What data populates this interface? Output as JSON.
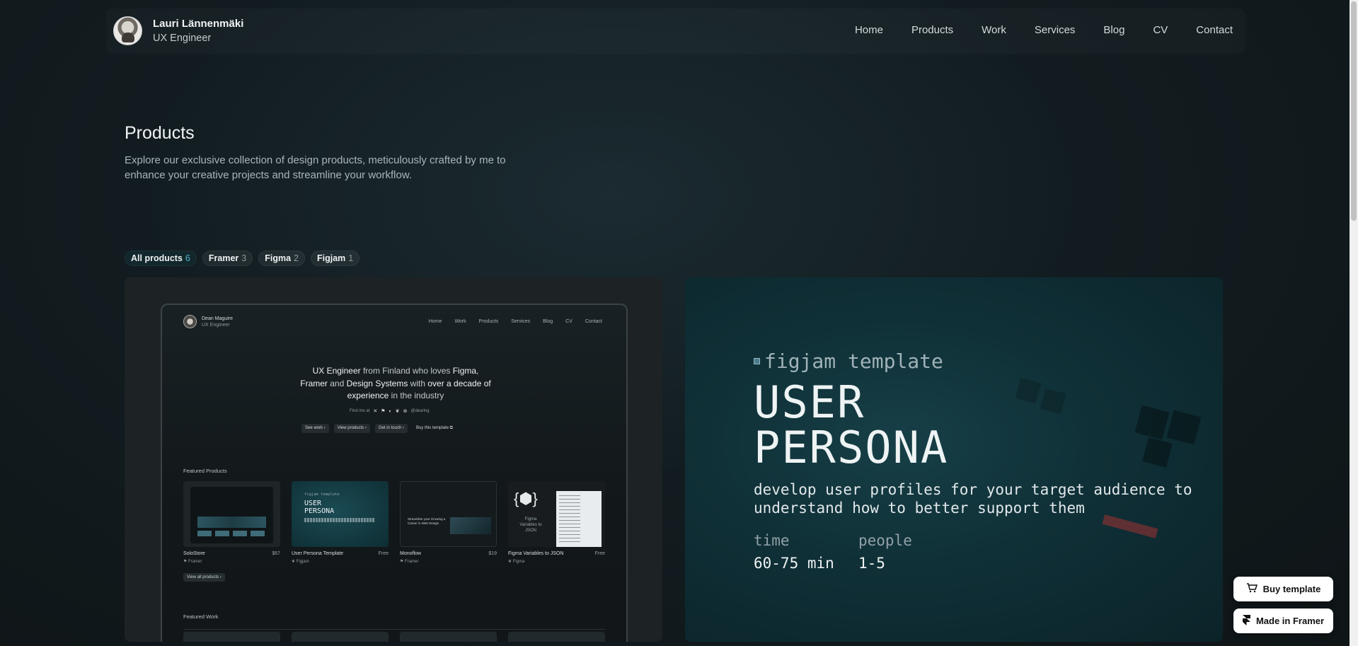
{
  "header": {
    "name": "Lauri Lännenmäki",
    "role": "UX Engineer",
    "nav": [
      "Home",
      "Products",
      "Work",
      "Services",
      "Blog",
      "CV",
      "Contact"
    ]
  },
  "intro": {
    "title": "Products",
    "description": "Explore our exclusive collection of design products, meticulously crafted by me to enhance your creative projects and streamline your workflow."
  },
  "filters": [
    {
      "label": "All products",
      "count": "6"
    },
    {
      "label": "Framer",
      "count": "3"
    },
    {
      "label": "Figma",
      "count": "2"
    },
    {
      "label": "Figjam",
      "count": "1"
    }
  ],
  "preview": {
    "name": "Dean Maguire",
    "role": "UX Engineer",
    "nav": [
      "Home",
      "Work",
      "Products",
      "Services",
      "Blog",
      "CV",
      "Contact"
    ],
    "hero": {
      "p1": "UX Engineer",
      "p2": " from Finland who loves ",
      "p3": "Figma",
      "p4": ",",
      "p5": "Framer",
      "p6": " and ",
      "p7": "Design Systems",
      "p8": " with ",
      "p9": "over a decade of experience",
      "p10": " in the industry"
    },
    "find_me": "Find me at",
    "handle": "@dearing",
    "buttons": [
      "See work",
      "View products",
      "Get in touch",
      "Buy this template"
    ],
    "featured_title": "Featured Products",
    "products": [
      {
        "name": "SoloStore",
        "price": "$67",
        "tag": "Framer"
      },
      {
        "name": "User Persona Template",
        "price": "Free",
        "tag": "Figjam"
      },
      {
        "name": "Monoflow",
        "price": "$19",
        "tag": "Framer"
      },
      {
        "name": "Figma Variables to JSON",
        "price": "Free",
        "tag": "Figma"
      }
    ],
    "view_all": "View all products",
    "work_title": "Featured Work",
    "mini_persona": {
      "label": "figjam template",
      "title_1": "USER",
      "title_2": "PERSONA"
    },
    "mini_monoflow": "Streamline your Growing a Career in Web Design",
    "mini_figma": "Figma Variables to JSON"
  },
  "persona_card": {
    "label": "figjam template",
    "title_line1": "USER",
    "title_line2": "PERSONA",
    "description": "develop user profiles for your target audience to understand how to better support them",
    "time_label": "time",
    "time_value": "60-75 min",
    "people_label": "people",
    "people_value": "1-5"
  },
  "floating": {
    "buy": "Buy template",
    "made": "Made in Framer"
  }
}
